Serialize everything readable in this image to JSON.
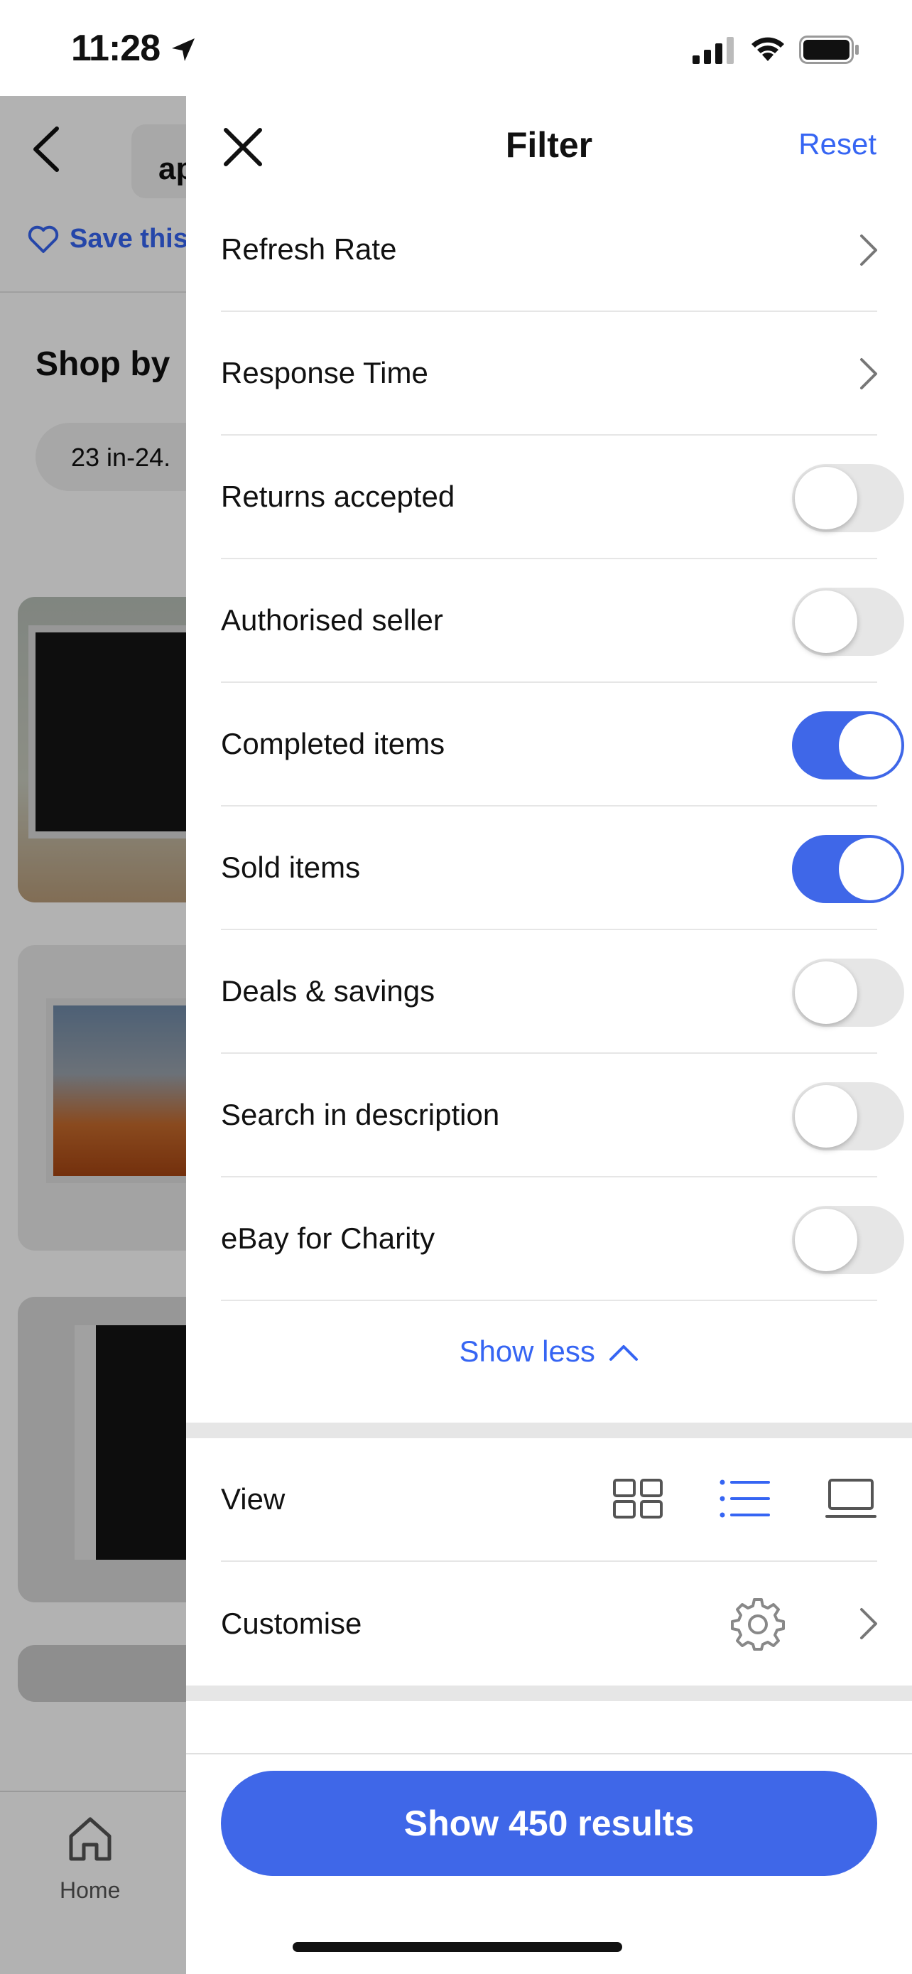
{
  "status_bar": {
    "time": "11:28"
  },
  "background_page": {
    "search_text": "ap",
    "save_label": "Save this",
    "shop_by_title": "Shop by",
    "chip_label": "23 in-24.",
    "tab_home_label": "Home"
  },
  "filter": {
    "title": "Filter",
    "reset_label": "Reset",
    "rows": [
      {
        "label": "Refresh Rate",
        "control": "chevron"
      },
      {
        "label": "Response Time",
        "control": "chevron"
      },
      {
        "label": "Returns accepted",
        "control": "toggle",
        "on": false
      },
      {
        "label": "Authorised seller",
        "control": "toggle",
        "on": false
      },
      {
        "label": "Completed items",
        "control": "toggle",
        "on": true
      },
      {
        "label": "Sold items",
        "control": "toggle",
        "on": true
      },
      {
        "label": "Deals & savings",
        "control": "toggle",
        "on": false
      },
      {
        "label": "Search in description",
        "control": "toggle",
        "on": false
      },
      {
        "label": "eBay for Charity",
        "control": "toggle",
        "on": false
      }
    ],
    "show_less_label": "Show less",
    "view_label": "View",
    "view_selected": "list",
    "customise_label": "Customise",
    "show_results_label": "Show 450 results"
  },
  "colors": {
    "accent": "#3f67e8",
    "link": "#3665f3"
  },
  "icons": [
    "location-arrow-icon",
    "signal-icon",
    "wifi-icon",
    "battery-icon",
    "close-icon",
    "chevron-right-icon",
    "chevron-up-icon",
    "grid-view-icon",
    "list-view-icon",
    "gallery-view-icon",
    "gear-icon",
    "heart-icon",
    "home-icon",
    "back-arrow-icon"
  ]
}
